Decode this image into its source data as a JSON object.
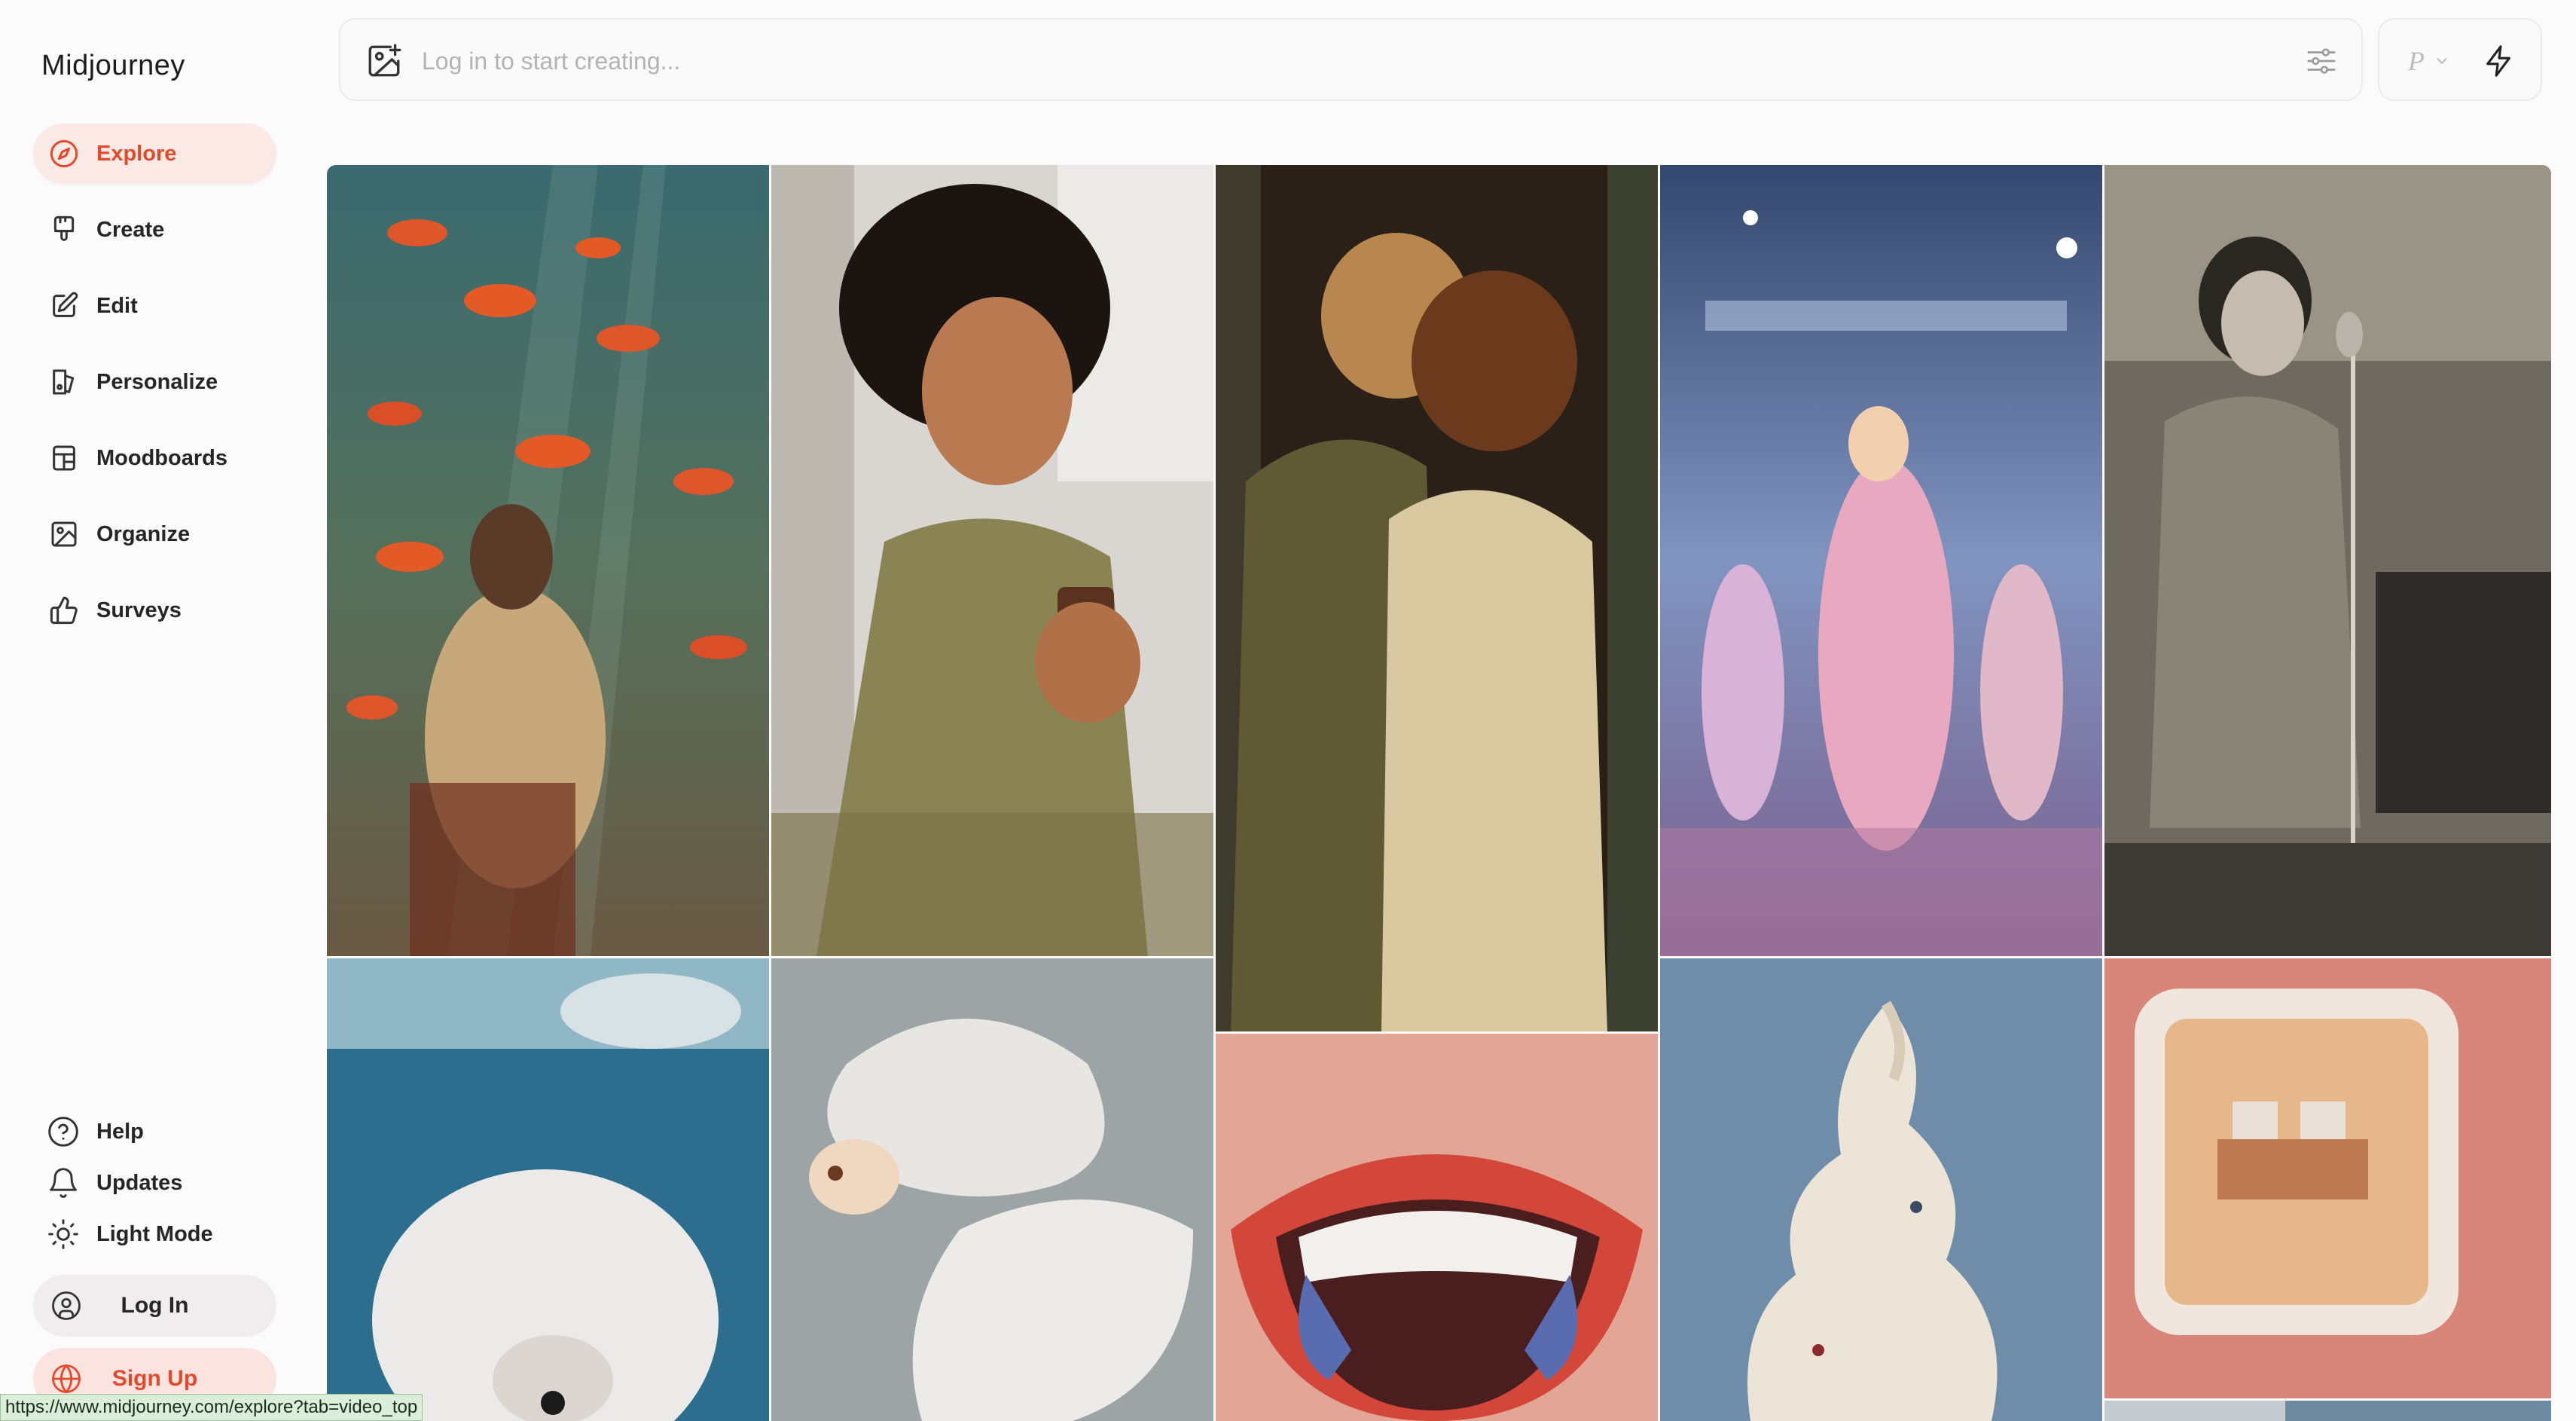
{
  "app": {
    "brand": "Midjourney"
  },
  "sidebar": {
    "items": [
      {
        "label": "Explore",
        "icon": "compass-icon",
        "active": true
      },
      {
        "label": "Create",
        "icon": "brush-icon"
      },
      {
        "label": "Edit",
        "icon": "edit-icon"
      },
      {
        "label": "Personalize",
        "icon": "personalize-icon"
      },
      {
        "label": "Moodboards",
        "icon": "moodboard-icon"
      },
      {
        "label": "Organize",
        "icon": "image-folder-icon"
      },
      {
        "label": "Surveys",
        "icon": "thumbs-up-icon"
      }
    ],
    "bottom": [
      {
        "label": "Help",
        "icon": "help-icon"
      },
      {
        "label": "Updates",
        "icon": "bell-icon"
      },
      {
        "label": "Light Mode",
        "icon": "sun-icon"
      }
    ],
    "login_label": "Log In",
    "signup_label": "Sign Up"
  },
  "topbar": {
    "placeholder": "Log in to start creating...",
    "p_label": "P"
  },
  "gallery": {
    "tiles": [
      "Woman sitting underwater among goldfish",
      "Woman holding skincare bottle",
      "Soldier kissing woman in doorway",
      "Idol performers on concert stage",
      "Vintage girl singing at microphone",
      "White dog lying by pool",
      "White betta fish",
      "Cartoon open mouth with teeth",
      "Miniature climbers on soft-serve ice cream",
      "Miniature office inside a frame",
      "City rooftop view"
    ]
  },
  "status": {
    "url": "https://www.midjourney.com/explore?tab=video_top"
  },
  "colors": {
    "accent": "#e34a2c",
    "active_bg": "#fbe9e6",
    "page_bg": "#fcfbfb"
  }
}
